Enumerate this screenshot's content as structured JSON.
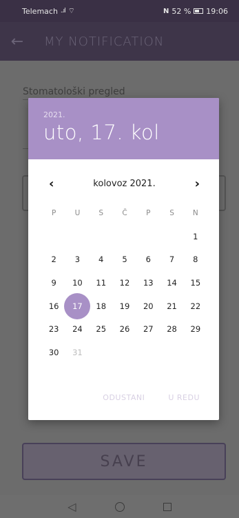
{
  "status_bar": {
    "carrier": "Telemach",
    "signal": "..ıl",
    "wifi": "⌔",
    "nfc": "N",
    "battery": "52 %",
    "time": "19:06"
  },
  "app_bar": {
    "back_icon": "arrow-back-icon",
    "title": "MY NOTIFICATION"
  },
  "form": {
    "field1": "Stomatološki pregled",
    "save_label": "SAVE"
  },
  "dialog": {
    "year": "2021.",
    "date_label": "uto, 17. kol",
    "month_label": "kolovoz 2021.",
    "prev_icon": "chevron-left-icon",
    "next_icon": "chevron-right-icon",
    "weekdays": [
      "P",
      "U",
      "S",
      "Č",
      "P",
      "S",
      "N"
    ],
    "weeks": [
      [
        "",
        "",
        "",
        "",
        "",
        "",
        "1"
      ],
      [
        "2",
        "3",
        "4",
        "5",
        "6",
        "7",
        "8"
      ],
      [
        "9",
        "10",
        "11",
        "12",
        "13",
        "14",
        "15"
      ],
      [
        "16",
        "17",
        "18",
        "19",
        "20",
        "21",
        "22"
      ],
      [
        "23",
        "24",
        "25",
        "26",
        "27",
        "28",
        "29"
      ],
      [
        "30",
        "31",
        "",
        "",
        "",
        "",
        ""
      ]
    ],
    "selected_day": "17",
    "disabled_days": [
      "31"
    ],
    "cancel_label": "ODUSTANI",
    "ok_label": "U REDU"
  },
  "colors": {
    "accent": "#a890c6",
    "app_bar": "#3e3549"
  }
}
